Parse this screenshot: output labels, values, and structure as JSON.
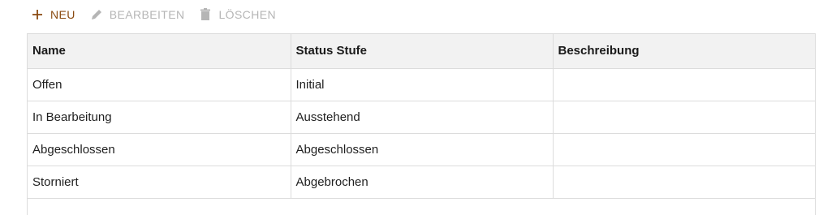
{
  "toolbar": {
    "new_label": "NEU",
    "edit_label": "BEARBEITEN",
    "delete_label": "LÖSCHEN",
    "accent_color": "#8a4a10",
    "disabled_color": "#b5b5b5",
    "icons": {
      "new": "plus-icon",
      "edit": "pencil-icon",
      "delete": "trash-icon"
    }
  },
  "table": {
    "headers": [
      "Name",
      "Status Stufe",
      "Beschreibung"
    ],
    "rows": [
      [
        "Offen",
        "Initial",
        ""
      ],
      [
        "In Bearbeitung",
        "Ausstehend",
        ""
      ],
      [
        "Abgeschlossen",
        "Abgeschlossen",
        ""
      ],
      [
        "Storniert",
        "Abgebrochen",
        ""
      ]
    ]
  }
}
